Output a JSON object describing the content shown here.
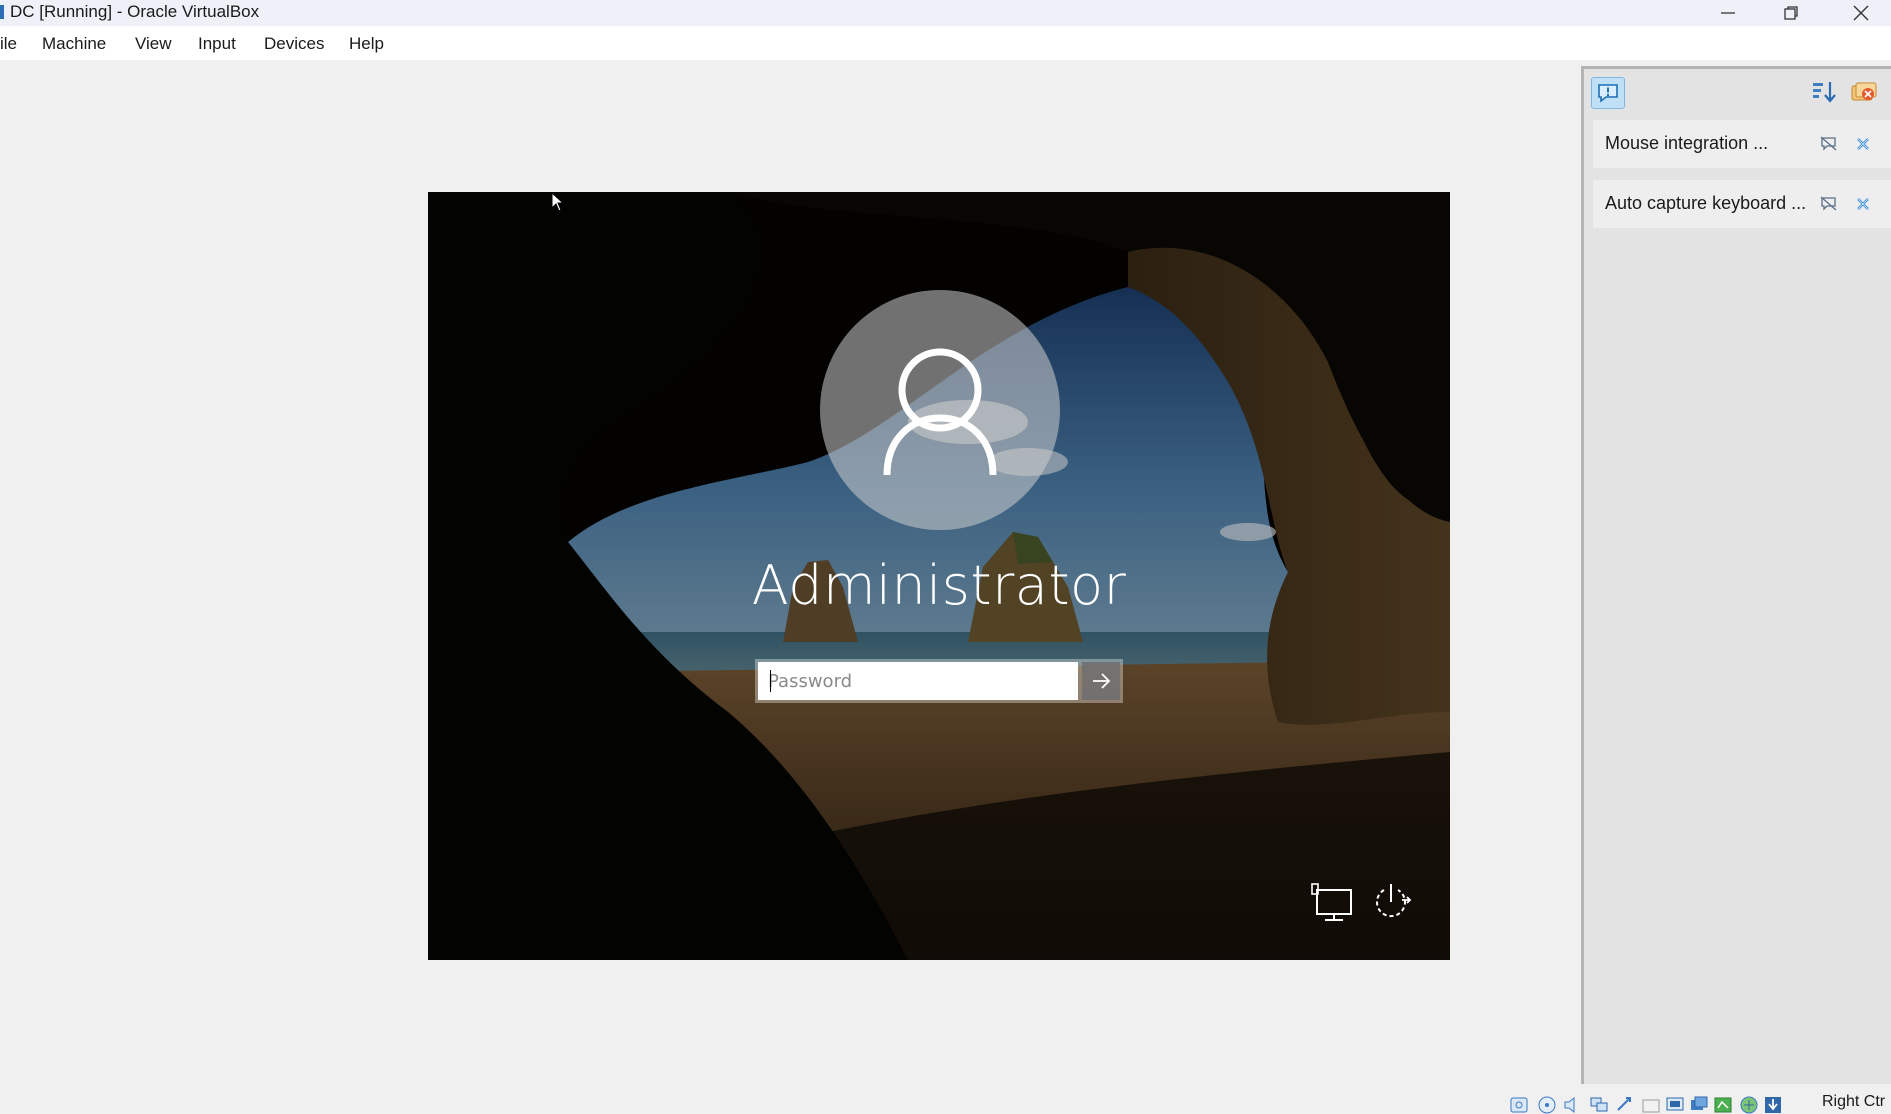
{
  "window": {
    "title": "DC [Running] - Oracle VirtualBox"
  },
  "menu": {
    "items": [
      "ile",
      "Machine",
      "View",
      "Input",
      "Devices",
      "Help"
    ]
  },
  "guest": {
    "username": "Administrator",
    "password_placeholder": "Password",
    "icons": [
      "network-icon",
      "power-options-icon",
      "user-avatar-icon",
      "submit-arrow-icon"
    ]
  },
  "notifications": {
    "items": [
      {
        "label": "Mouse integration ..."
      },
      {
        "label": "Auto capture keyboard ..."
      }
    ]
  },
  "statusbar": {
    "host_key": "Right Ctr"
  },
  "colors": {
    "accent": "#2e6db4",
    "panel_bg": "#e3e3e3",
    "notif_bg": "#eeeeee"
  }
}
